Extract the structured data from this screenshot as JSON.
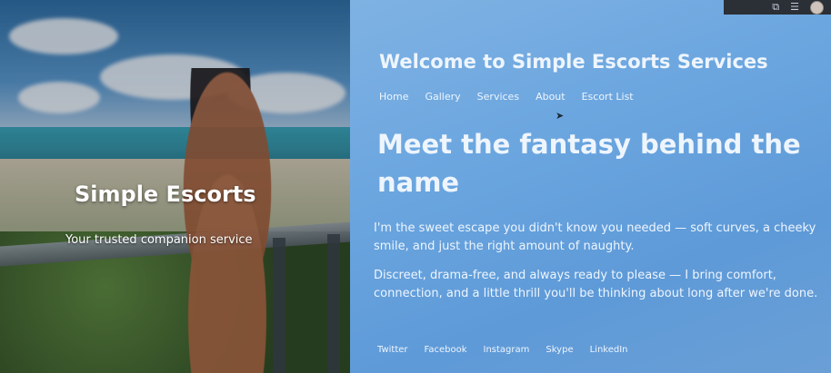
{
  "hero": {
    "title": "Simple Escorts",
    "subtitle": "Your trusted companion service"
  },
  "header": {
    "site_title": "Welcome to Simple Escorts Services"
  },
  "nav": {
    "items": [
      {
        "label": "Home"
      },
      {
        "label": "Gallery"
      },
      {
        "label": "Services"
      },
      {
        "label": "About"
      },
      {
        "label": "Escort List"
      }
    ]
  },
  "main": {
    "headline": "Meet the fantasy behind the name",
    "paragraph_1": "I'm the sweet escape you didn't know you needed — soft curves, a cheeky smile, and just the right amount of naughty.",
    "paragraph_2": "Discreet, drama-free, and always ready to please — I bring comfort, connection, and a little thrill you'll be thinking about long after we're done."
  },
  "footer": {
    "social": [
      {
        "label": "Twitter"
      },
      {
        "label": "Facebook"
      },
      {
        "label": "Instagram"
      },
      {
        "label": "Skype"
      },
      {
        "label": "LinkedIn"
      }
    ]
  },
  "colors": {
    "content_bg": "#6aa5df",
    "text": "#eef5fd"
  },
  "icons": {
    "topbar": [
      "extension-icon",
      "reading-list-icon",
      "profile-avatar"
    ]
  }
}
